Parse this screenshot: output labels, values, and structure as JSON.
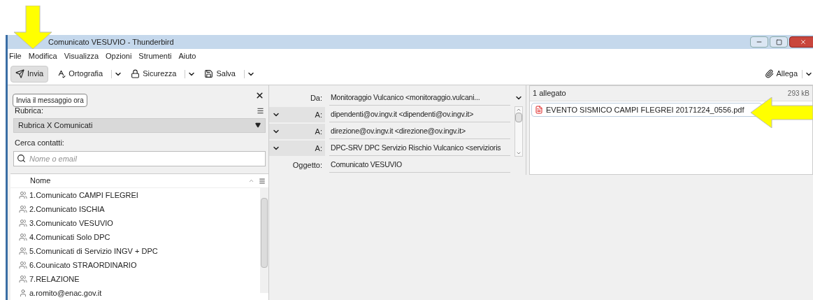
{
  "window": {
    "title": "Comunicato VESUVIO - Thunderbird"
  },
  "menu": [
    "File",
    "Modifica",
    "Visualizza",
    "Opzioni",
    "Strumenti",
    "Aiuto"
  ],
  "toolbar": [
    {
      "label": "Invia",
      "kind": "send",
      "pressed": true
    },
    {
      "label": "Ortografia",
      "kind": "spell",
      "pressed": false
    },
    {
      "label": "Sicurezza",
      "kind": "lock",
      "pressed": false
    },
    {
      "label": "Salva",
      "kind": "save",
      "pressed": false
    }
  ],
  "attach_button": "Allega",
  "tooltip": "Invia il messaggio ora",
  "sidebar": {
    "address_book_label": "Rubrica:",
    "address_book": "Rubrica X Comunicati",
    "search_label": "Cerca contatti:",
    "search_placeholder": "Nome o email",
    "column": "Nome",
    "contacts": [
      {
        "name": "1.Comunicato CAMPI FLEGREI",
        "kind": "list"
      },
      {
        "name": "2.Comunicato ISCHIA",
        "kind": "list"
      },
      {
        "name": "3.Comunicato VESUVIO",
        "kind": "list"
      },
      {
        "name": "4.Comunicati Solo DPC",
        "kind": "list"
      },
      {
        "name": "5.Comunicati di Servizio INGV + DPC",
        "kind": "list"
      },
      {
        "name": "6.Counicato STRAORDINARIO",
        "kind": "list"
      },
      {
        "name": "7.RELAZIONE",
        "kind": "list"
      },
      {
        "name": "a.romito@enac.gov.it",
        "kind": "person"
      }
    ]
  },
  "header": {
    "fields": [
      {
        "label": "Da:",
        "value": "Monitoraggio Vulcanico <monitoraggio.vulcani...",
        "kind": "from"
      },
      {
        "label": "A:",
        "value": "dipendenti@ov.ingv.it <dipendenti@ov.ingv.it>",
        "kind": "to"
      },
      {
        "label": "A:",
        "value": "direzione@ov.ingv.it <direzione@ov.ingv.it>",
        "kind": "to"
      },
      {
        "label": "A:",
        "value": "DPC-SRV DPC Servizio Rischio Vulcanico <servizioris",
        "kind": "to"
      },
      {
        "label": "Oggetto:",
        "value": "Comunicato VESUVIO",
        "kind": "subject"
      }
    ]
  },
  "attachments": {
    "count": "1 allegato",
    "size": "293 kB",
    "files": [
      "EVENTO SISMICO CAMPI FLEGREI 20171224_0556.pdf"
    ]
  }
}
